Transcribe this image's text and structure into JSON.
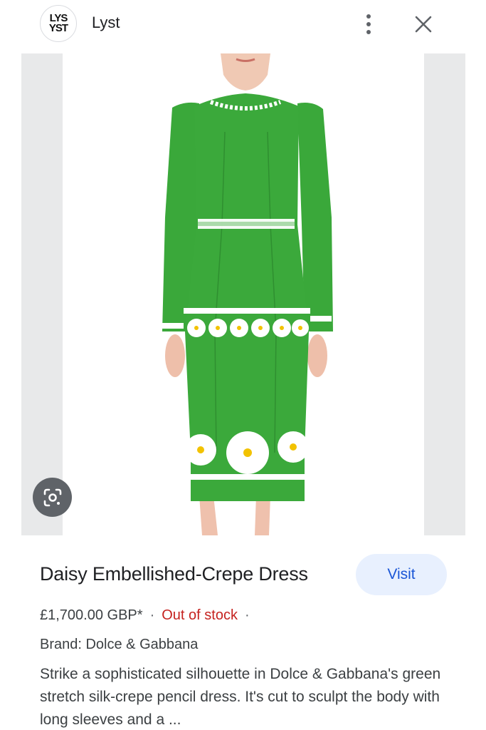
{
  "header": {
    "logo_text_line1": "LYS",
    "logo_text_line2": "YST",
    "site_name": "Lyst",
    "menu_icon": "more-vert-icon",
    "close_icon": "close-icon"
  },
  "image": {
    "alt": "Green dress with white daisy embellishments",
    "lens_icon": "google-lens-icon",
    "colors": {
      "dress": "#3aa83a",
      "panel": "#e8e9ea",
      "daisy": "#ffffff",
      "daisy_center": "#f2c200"
    }
  },
  "product": {
    "title": "Daisy Embellished-Crepe Dress",
    "visit_label": "Visit",
    "price": "£1,700.00 GBP*",
    "stock": "Out of stock",
    "brand": "Brand: Dolce & Gabbana",
    "description": "Strike a sophisticated silhouette in Dolce & Gabbana's green stretch silk-crepe pencil dress. It's cut to sculpt the body with long sleeves and a ..."
  },
  "colors": {
    "accent": "#1a56d6",
    "visit_bg": "#e8f0fe",
    "out_of_stock": "#c5221f"
  }
}
